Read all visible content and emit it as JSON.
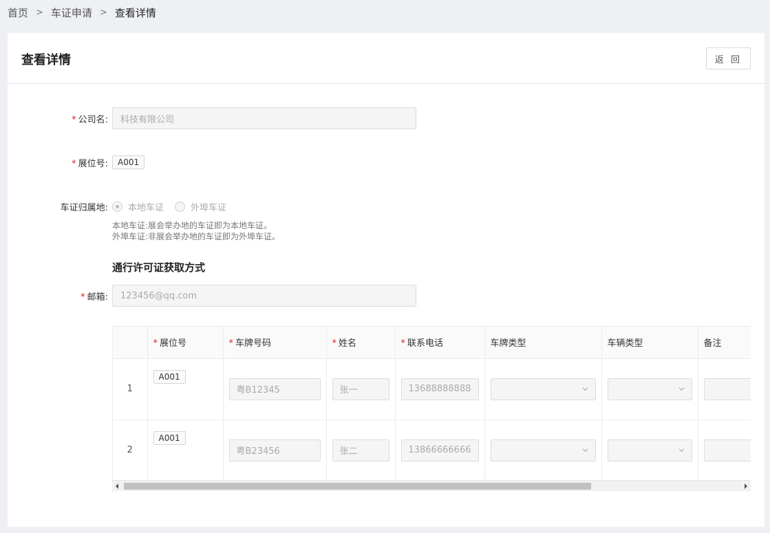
{
  "breadcrumb": {
    "home": "首页",
    "parent": "车证申请",
    "current": "查看详情",
    "separator": ">"
  },
  "header": {
    "title": "查看详情",
    "back_label": "返 回"
  },
  "form": {
    "company": {
      "label": "公司名:",
      "value": "科技有限公司"
    },
    "booth": {
      "label": "展位号:",
      "value": "A001"
    },
    "cert_origin": {
      "label": "车证归属地:",
      "options": [
        "本地车证",
        "外埠车证"
      ],
      "selected": "本地车证",
      "hint_local": "本地车证:展会举办地的车证即为本地车证。",
      "hint_remote": "外埠车证:非展会举办地的车证即为外埠车证。"
    },
    "section_title": "通行许可证获取方式",
    "email": {
      "label": "邮箱:",
      "value": "123456@qq.com"
    }
  },
  "required_mark": "*",
  "table": {
    "columns": [
      "展位号",
      "车牌号码",
      "姓名",
      "联系电话",
      "车牌类型",
      "车辆类型",
      "备注"
    ],
    "rows": [
      {
        "index": "1",
        "booth": "A001",
        "plate": "粤B12345",
        "name": "张一",
        "phone": "13688888888",
        "plate_type": "",
        "vehicle_type": "",
        "remark": ""
      },
      {
        "index": "2",
        "booth": "A001",
        "plate": "粤B23456",
        "name": "张二",
        "phone": "13866666666",
        "plate_type": "",
        "vehicle_type": "",
        "remark": ""
      }
    ]
  },
  "scroll": {
    "thumb_fraction": 0.76
  },
  "icons": {
    "chevron": "chevron-down-icon"
  }
}
